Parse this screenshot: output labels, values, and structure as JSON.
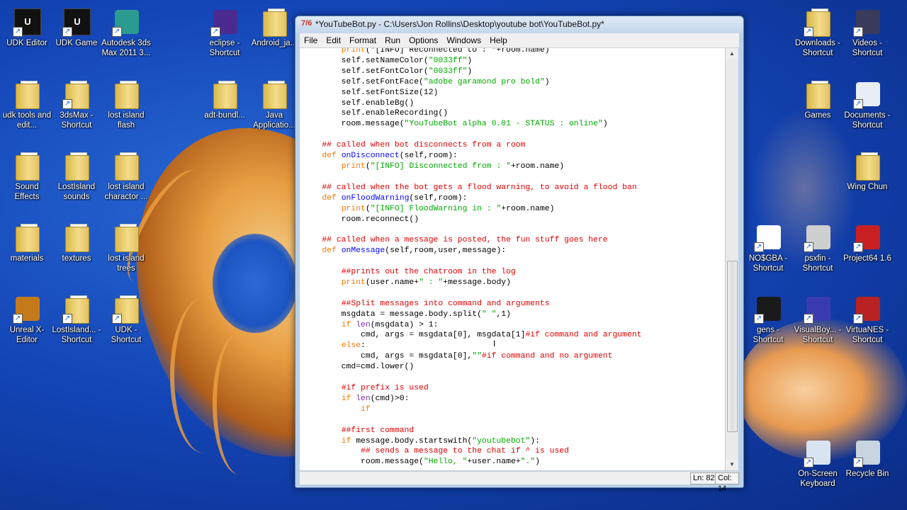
{
  "window": {
    "title": "*YouTubeBot.py - C:\\Users\\Jon Rollins\\Desktop\\youtube bot\\YouTubeBot.py*",
    "menu": [
      "File",
      "Edit",
      "Format",
      "Run",
      "Options",
      "Windows",
      "Help"
    ],
    "status": {
      "line": "Ln: 82",
      "col": "Col: 14"
    }
  },
  "desktop_icons_left": [
    {
      "label": "UDK Editor",
      "icon": "udk-icon"
    },
    {
      "label": "UDK Game",
      "icon": "udk-icon"
    },
    {
      "label": "Autodesk 3ds Max 2011 3...",
      "icon": "3dsmax-icon"
    },
    {
      "label": "eclipse - Shortcut",
      "icon": "eclipse-icon"
    },
    {
      "label": "Android_ja...",
      "icon": "folder-icon"
    },
    {
      "label": "udk tools and edit...",
      "icon": "folder-icon"
    },
    {
      "label": "3dsMax - Shortcut",
      "icon": "folder-icon"
    },
    {
      "label": "lost island flash",
      "icon": "folder-icon"
    },
    {
      "label": "adt-bundl...",
      "icon": "folder-icon"
    },
    {
      "label": "Java Applicatio...",
      "icon": "folder-icon"
    },
    {
      "label": "Sound Effects",
      "icon": "folder-icon"
    },
    {
      "label": "LostIsland sounds",
      "icon": "folder-icon"
    },
    {
      "label": "lost island charactor ...",
      "icon": "folder-icon"
    },
    {
      "label": "materials",
      "icon": "folder-icon"
    },
    {
      "label": "textures",
      "icon": "folder-icon"
    },
    {
      "label": "lost island trees",
      "icon": "folder-icon"
    },
    {
      "label": "Unreal X-Editor",
      "icon": "unreal-icon"
    },
    {
      "label": "LostIsland... - Shortcut",
      "icon": "folder-icon"
    },
    {
      "label": "UDK - Shortcut",
      "icon": "folder-icon"
    }
  ],
  "desktop_icons_right": [
    {
      "label": "Downloads - Shortcut",
      "icon": "folder-icon"
    },
    {
      "label": "Videos - Shortcut",
      "icon": "videos-icon"
    },
    {
      "label": "Games",
      "icon": "folder-icon"
    },
    {
      "label": "Documents - Shortcut",
      "icon": "documents-icon"
    },
    {
      "label": "Wing Chun",
      "icon": "folder-icon"
    },
    {
      "label": "NO$GBA - Shortcut",
      "icon": "nosgba-icon"
    },
    {
      "label": "psxfin - Shortcut",
      "icon": "psx-icon"
    },
    {
      "label": "Project64 1.6",
      "icon": "project64-icon"
    },
    {
      "label": "gens - Shortcut",
      "icon": "gens-icon"
    },
    {
      "label": "VisualBoy... - Shortcut",
      "icon": "visualboy-icon"
    },
    {
      "label": "VirtuaNES - Shortcut",
      "icon": "virtuanes-icon"
    },
    {
      "label": "On-Screen Keyboard",
      "icon": "keyboard-icon"
    },
    {
      "label": "Recycle Bin",
      "icon": "recycle-bin-icon"
    }
  ],
  "code_lines": [
    [
      [
        "        ",
        ""
      ],
      [
        "print",
        "kw"
      ],
      [
        "(\"[INFO] Reconnected to : \"+room.name)",
        ""
      ]
    ],
    [
      [
        "        self.setNameColor(",
        ""
      ],
      [
        "\"0033ff\"",
        "str"
      ],
      [
        ")",
        ""
      ]
    ],
    [
      [
        "        self.setFontColor(",
        ""
      ],
      [
        "\"0033ff\"",
        "str"
      ],
      [
        ")",
        ""
      ]
    ],
    [
      [
        "        self.setFontFace(",
        ""
      ],
      [
        "\"adobe garamond pro bold\"",
        "str"
      ],
      [
        ")",
        ""
      ]
    ],
    [
      [
        "        self.setFontSize(12)",
        ""
      ]
    ],
    [
      [
        "        self.enableBg()",
        ""
      ]
    ],
    [
      [
        "        self.enableRecording()",
        ""
      ]
    ],
    [
      [
        "        room.message(",
        ""
      ],
      [
        "\"YouTubeBot alpha 0.01 - STATUS : online\"",
        "str"
      ],
      [
        ")",
        ""
      ]
    ],
    [
      [
        "",
        ""
      ]
    ],
    [
      [
        "    ",
        ""
      ],
      [
        "## called when bot disconnects from a room",
        "cmt"
      ]
    ],
    [
      [
        "    ",
        ""
      ],
      [
        "def",
        "kw"
      ],
      [
        " ",
        ""
      ],
      [
        "onDisconnect",
        "fn"
      ],
      [
        "(self,room):",
        ""
      ]
    ],
    [
      [
        "        ",
        ""
      ],
      [
        "print",
        "kw"
      ],
      [
        "(",
        ""
      ],
      [
        "\"[INFO] Disconnected from : \"",
        "str"
      ],
      [
        "+room.name)",
        ""
      ]
    ],
    [
      [
        "",
        ""
      ]
    ],
    [
      [
        "    ",
        ""
      ],
      [
        "## called when the bot gets a flood warning, to avoid a flood ban",
        "cmt"
      ]
    ],
    [
      [
        "    ",
        ""
      ],
      [
        "def",
        "kw"
      ],
      [
        " ",
        ""
      ],
      [
        "onFloodWarning",
        "fn"
      ],
      [
        "(self,room):",
        ""
      ]
    ],
    [
      [
        "        ",
        ""
      ],
      [
        "print",
        "kw"
      ],
      [
        "(",
        ""
      ],
      [
        "\"[INFO] FloodWarning in : \"",
        "str"
      ],
      [
        "+room.name)",
        ""
      ]
    ],
    [
      [
        "        room.reconnect()",
        ""
      ]
    ],
    [
      [
        "",
        ""
      ]
    ],
    [
      [
        "    ",
        ""
      ],
      [
        "## called when a message is posted, the fun stuff goes here",
        "cmt"
      ]
    ],
    [
      [
        "    ",
        ""
      ],
      [
        "def",
        "kw"
      ],
      [
        " ",
        ""
      ],
      [
        "onMessage",
        "fn"
      ],
      [
        "(self,room,user,message):",
        ""
      ]
    ],
    [
      [
        "",
        ""
      ]
    ],
    [
      [
        "        ",
        ""
      ],
      [
        "##prints out the chatroom in the log",
        "cmt"
      ]
    ],
    [
      [
        "        ",
        ""
      ],
      [
        "print",
        "kw"
      ],
      [
        "(user.name+",
        ""
      ],
      [
        "\" : \"",
        "str"
      ],
      [
        "+message.body)",
        ""
      ]
    ],
    [
      [
        "",
        ""
      ]
    ],
    [
      [
        "        ",
        ""
      ],
      [
        "##Split messages into command and arguments",
        "cmt"
      ]
    ],
    [
      [
        "        msgdata = message.body.split(",
        ""
      ],
      [
        "\" \"",
        "str"
      ],
      [
        ",1)",
        ""
      ]
    ],
    [
      [
        "        ",
        ""
      ],
      [
        "if",
        "kw"
      ],
      [
        " ",
        ""
      ],
      [
        "len",
        "kw2"
      ],
      [
        "(msgdata) > 1:",
        ""
      ]
    ],
    [
      [
        "            cmd, args = msgdata[0], msgdata[1]",
        ""
      ],
      [
        "#if command and argument",
        "cmt"
      ]
    ],
    [
      [
        "        ",
        ""
      ],
      [
        "else",
        "kw"
      ],
      [
        ":",
        ""
      ]
    ],
    [
      [
        "            cmd, args = msgdata[0],",
        ""
      ],
      [
        "\"\"",
        "str"
      ],
      [
        "#if command and no argument",
        "cmt"
      ]
    ],
    [
      [
        "        cmd=cmd.lower()",
        ""
      ]
    ],
    [
      [
        "",
        ""
      ]
    ],
    [
      [
        "        ",
        ""
      ],
      [
        "#if prefix is used",
        "cmt"
      ]
    ],
    [
      [
        "        ",
        ""
      ],
      [
        "if",
        "kw"
      ],
      [
        " ",
        ""
      ],
      [
        "len",
        "kw2"
      ],
      [
        "(cmd)>0:",
        ""
      ]
    ],
    [
      [
        "            ",
        ""
      ],
      [
        "if",
        "kw"
      ]
    ],
    [
      [
        "",
        ""
      ]
    ],
    [
      [
        "        ",
        ""
      ],
      [
        "##first command",
        "cmt"
      ]
    ],
    [
      [
        "        ",
        ""
      ],
      [
        "if",
        "kw"
      ],
      [
        " message.body.startswith(",
        ""
      ],
      [
        "\"youtubebot\"",
        "str"
      ],
      [
        "):",
        ""
      ]
    ],
    [
      [
        "            ",
        ""
      ],
      [
        "## sends a message to the chat if ^ is used",
        "cmt"
      ]
    ],
    [
      [
        "            room.message(",
        ""
      ],
      [
        "\"Hello, \"",
        "str"
      ],
      [
        "+user.name+",
        ""
      ],
      [
        "\".\"",
        "str"
      ],
      [
        ")",
        ""
      ]
    ]
  ]
}
